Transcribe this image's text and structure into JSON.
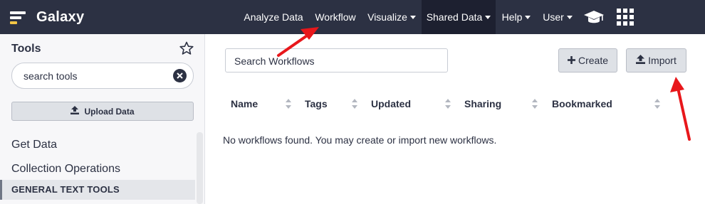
{
  "masthead": {
    "brand": "Galaxy",
    "nav": [
      {
        "label": "Analyze Data",
        "dropdown": false
      },
      {
        "label": "Workflow",
        "dropdown": false
      },
      {
        "label": "Visualize",
        "dropdown": true
      },
      {
        "label": "Shared Data",
        "dropdown": true,
        "active": true
      },
      {
        "label": "Help",
        "dropdown": true
      },
      {
        "label": "User",
        "dropdown": true
      }
    ],
    "icons": [
      "graduation-cap-icon",
      "apps-grid-icon"
    ]
  },
  "sidebar": {
    "title": "Tools",
    "search": {
      "placeholder": "search tools",
      "value": ""
    },
    "upload_label": "Upload Data",
    "sections": [
      "Get Data",
      "Collection Operations"
    ],
    "section_header": "GENERAL TEXT TOOLS"
  },
  "main": {
    "search": {
      "placeholder": "Search Workflows",
      "value": ""
    },
    "create_label": "Create",
    "import_label": "Import",
    "columns": [
      "Name",
      "Tags",
      "Updated",
      "Sharing",
      "Bookmarked"
    ],
    "empty_message": "No workflows found. You may create or import new workflows."
  },
  "colors": {
    "masthead_bg": "#2c3143",
    "active_nav_bg": "#1d2030",
    "logo_accent": "#f3c545",
    "annotation_arrow": "#e8171b"
  }
}
